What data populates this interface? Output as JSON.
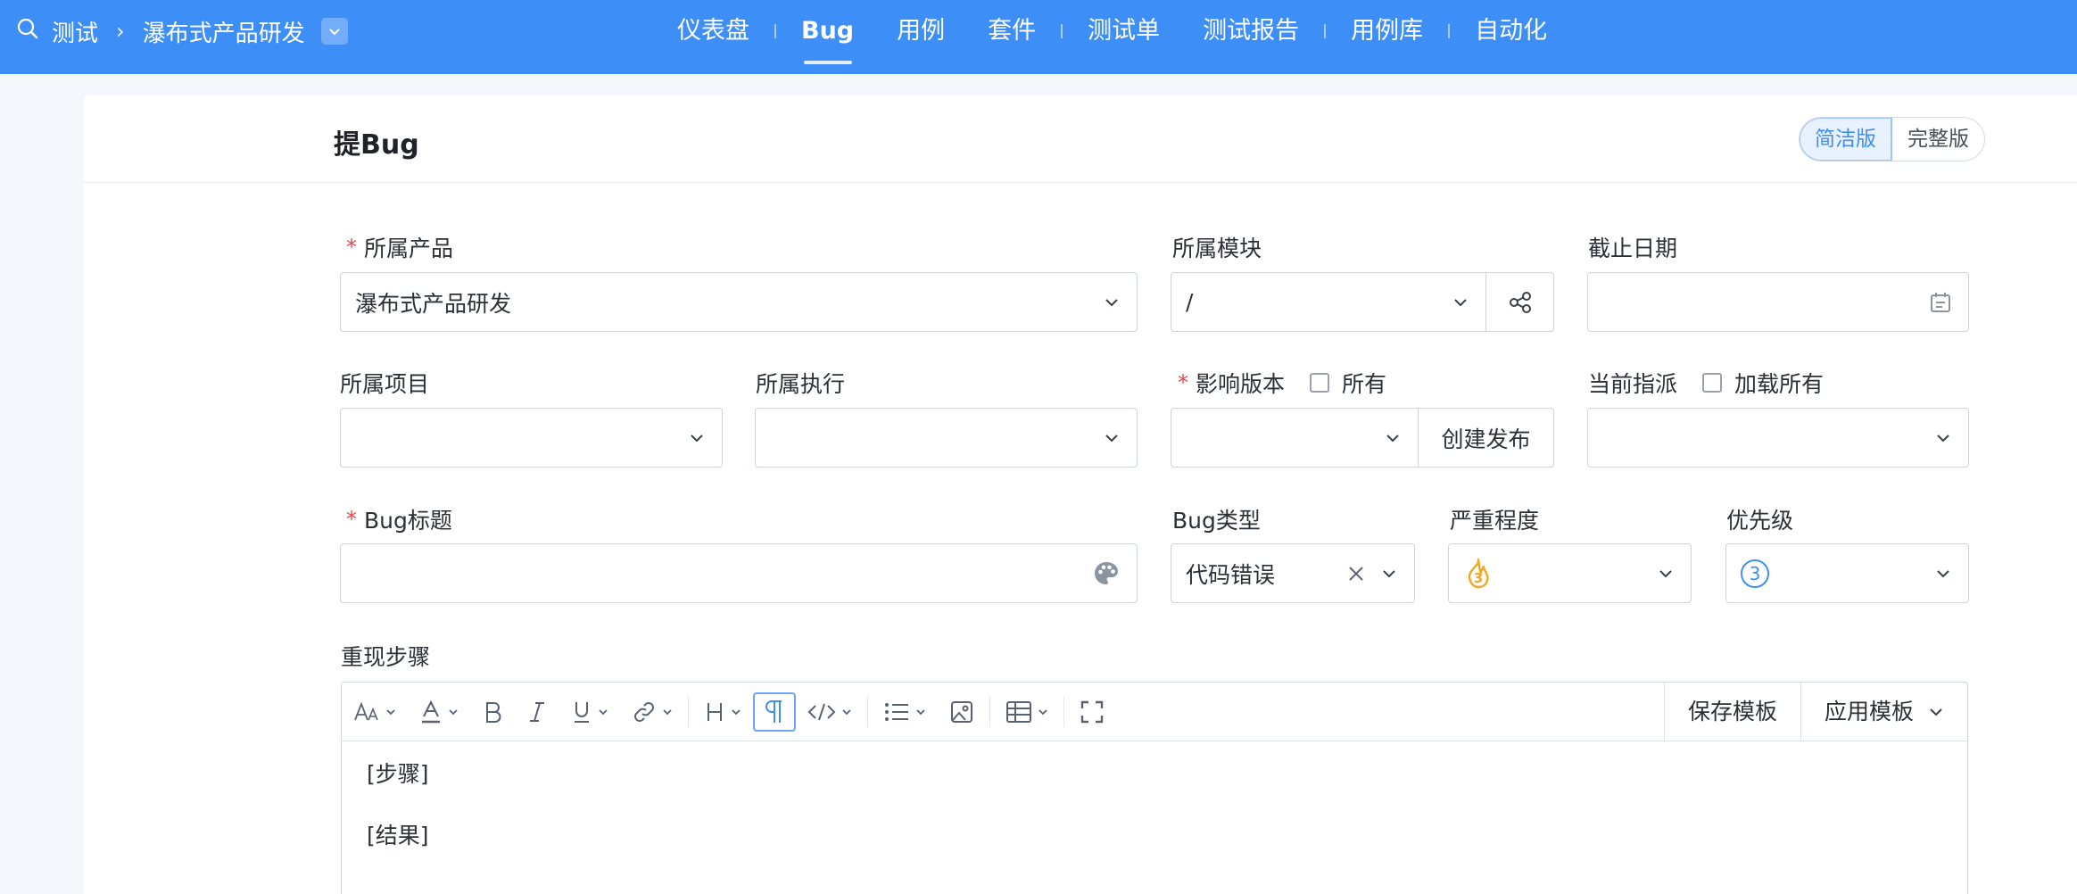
{
  "topbar": {
    "breadcrumb_root": "测试",
    "breadcrumb_product": "瀑布式产品研发",
    "nav": [
      "仪表盘",
      "Bug",
      "用例",
      "套件",
      "测试单",
      "测试报告",
      "用例库",
      "自动化"
    ]
  },
  "page": {
    "title": "提Bug",
    "mode_simple": "简洁版",
    "mode_full": "完整版"
  },
  "form": {
    "product_label": "所属产品",
    "product_value": "瀑布式产品研发",
    "module_label": "所属模块",
    "module_value": "/",
    "deadline_label": "截止日期",
    "project_label": "所属项目",
    "execution_label": "所属执行",
    "build_label": "影响版本",
    "build_all_label": "所有",
    "build_create_label": "创建发布",
    "assign_label": "当前指派",
    "assign_load_all_label": "加载所有",
    "title_label": "Bug标题",
    "type_label": "Bug类型",
    "type_value": "代码错误",
    "severity_label": "严重程度",
    "severity_value": "3",
    "priority_label": "优先级",
    "priority_value": "3",
    "steps_label": "重现步骤"
  },
  "editor": {
    "save_template": "保存模板",
    "apply_template": "应用模板",
    "lines": [
      "[步骤]",
      "[结果]"
    ]
  },
  "colors": {
    "primary": "#3e8ef7",
    "required": "#e5484d",
    "severity": "#f5a623"
  }
}
